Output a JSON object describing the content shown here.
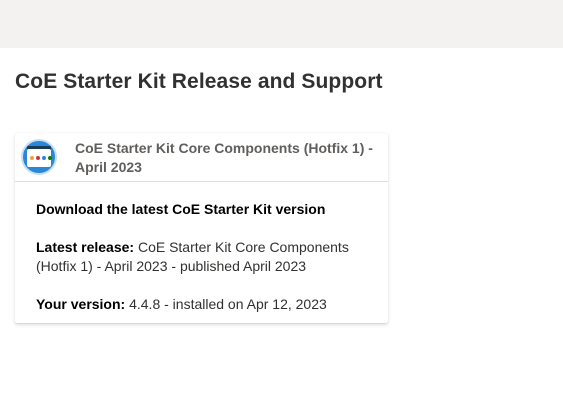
{
  "page": {
    "title": "CoE Starter Kit Release and Support"
  },
  "card": {
    "icon": "coe-starter-kit-app-icon",
    "title": "CoE Starter Kit Core Components (Hotfix 1) - April 2023",
    "heading": "Download the latest CoE Starter Kit version",
    "latest_release_label": "Latest release:",
    "latest_release_value": "CoE Starter Kit Core Components (Hotfix 1) - April 2023 - published April 2023",
    "your_version_label": "Your version:",
    "your_version_value": "4.4.8 - installed on Apr 12, 2023"
  },
  "colors": {
    "top_band": "#f3f2f1",
    "icon_accent": "#2b88d8"
  }
}
